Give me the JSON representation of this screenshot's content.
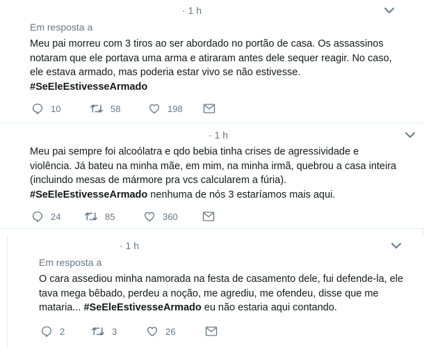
{
  "tweets": [
    {
      "time": "· 1 h",
      "reply_label": "Em resposta a",
      "lines": [
        "Meu pai morreu com 3 tiros ao ser abordado no portão de casa. Os assassinos",
        "notaram que ele portava uma arma e atiraram antes dele sequer reagir. No caso,",
        "ele estava armado, mas poderia estar vivo se não estivesse."
      ],
      "hashtag": "#SeEleEstivesseArmado",
      "hashtag_suffix": "",
      "replies": "10",
      "retweets": "58",
      "likes": "198"
    },
    {
      "time": "· 1 h",
      "reply_label": "",
      "lines": [
        "Meu pai sempre foi alcoólatra e qdo bebia tinha crises de agressividade e",
        "violência. Já bateu na minha mãe, em mim, na minha irmã, quebrou a casa inteira",
        "(incluindo mesas de mármore pra vcs calcularem a fúria)."
      ],
      "hashtag": "#SeEleEstivesseArmado",
      "hashtag_suffix": " nenhuma de nós 3 estaríamos mais aqui.",
      "replies": "24",
      "retweets": "85",
      "likes": "360"
    },
    {
      "time": "· 1 h",
      "reply_label": "Em resposta a",
      "lines": [
        "O cara assediou minha namorada na festa de casamento dele, fui defende-la, ele",
        "tava mega bêbado, perdeu a noção, me agrediu, me ofendeu, disse que me"
      ],
      "hashtag_prefix": "mataria... ",
      "hashtag": "#SeEleEstivesseArmado",
      "hashtag_suffix": " eu não estaria aqui contando.",
      "replies": "2",
      "retweets": "3",
      "likes": "26"
    }
  ],
  "colors": {
    "text": "#14171a",
    "muted": "#657786",
    "border": "#e6ecf0"
  },
  "icons": [
    "reply-icon",
    "retweet-icon",
    "like-icon",
    "direct-message-icon",
    "chevron-down-icon"
  ]
}
